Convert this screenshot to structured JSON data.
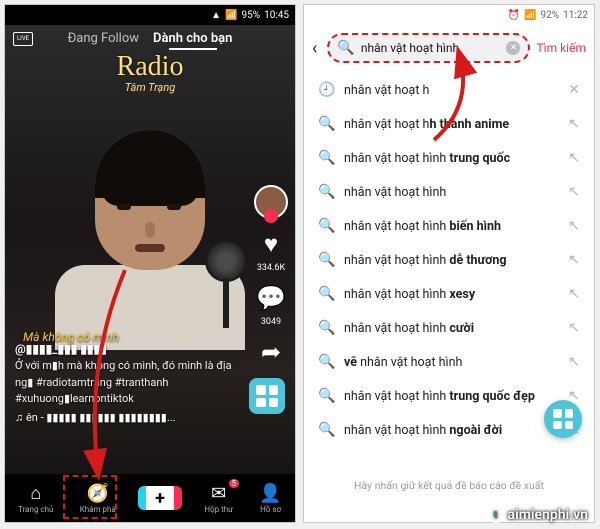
{
  "left": {
    "status": {
      "battery": "95%",
      "time": "10:45"
    },
    "tabs": {
      "live": "LIVE",
      "following": "Đang Follow",
      "foryou": "Dành cho bạn"
    },
    "brand": {
      "title": "Radio",
      "subtitle": "Tâm Trạng"
    },
    "rail": {
      "likes": "334.6K",
      "comments": "3049"
    },
    "caption_yellow": "Mà không có mình",
    "meta": {
      "username": "@▮▮▮▮_▮▮▮ ▮▮▮▮",
      "desc": "Ở với m▮h mà không có mình, đó mình là địa ng▮ #radiotamtrang #tranthanh #xuhuong▮learnontiktok",
      "track": "♫ ên - ▮▮▮▮▮ ▮▮▮▮▮▮ ▮▮▮▮▮▮▮▮..."
    },
    "nav": {
      "home": "Trang chủ",
      "discover": "Khám phá",
      "inbox": "Hộp thư",
      "inbox_badge": "5",
      "profile": "Hồ sơ"
    }
  },
  "right": {
    "status": {
      "battery": "92%",
      "time": "11:22"
    },
    "search": {
      "query": "nhân vật hoạt hình",
      "action": "Tìm kiếm"
    },
    "suggestions": [
      {
        "lead": "history",
        "pre": "nhân vật hoạt h",
        "bold": "",
        "tail": "close"
      },
      {
        "lead": "search",
        "pre": "nhân vật hoạt h",
        "bold": "h thành anime",
        "tail": "go"
      },
      {
        "lead": "search",
        "pre": "nhân vật hoạt hình ",
        "bold": "trung quốc",
        "tail": "go"
      },
      {
        "lead": "search",
        "pre": "nhân vật hoạt hình",
        "bold": "",
        "tail": "go"
      },
      {
        "lead": "search",
        "pre": "nhân vật hoạt hình ",
        "bold": "biến hình",
        "tail": "go"
      },
      {
        "lead": "search",
        "pre": "nhân vật hoạt hình ",
        "bold": "dễ thương",
        "tail": "go"
      },
      {
        "lead": "search",
        "pre": "nhân vật hoạt hình ",
        "bold": "xesy",
        "tail": "go"
      },
      {
        "lead": "search",
        "pre": "nhân vật hoạt hình ",
        "bold": "cười",
        "tail": "go"
      },
      {
        "lead": "search",
        "pre": "",
        "bold": "vẽ",
        "post": " nhân vật hoạt hình",
        "tail": "go"
      },
      {
        "lead": "search",
        "pre": "nhân vật hoạt hình ",
        "bold": "trung quốc đẹp",
        "tail": "go"
      },
      {
        "lead": "search",
        "pre": "nhân vật hoạt hình ",
        "bold": "ngoài đời",
        "tail": "go"
      }
    ],
    "hint": "Hãy nhấn giữ kết quả đề báo cáo đề xuất"
  },
  "watermark": "aimienphi.vn"
}
